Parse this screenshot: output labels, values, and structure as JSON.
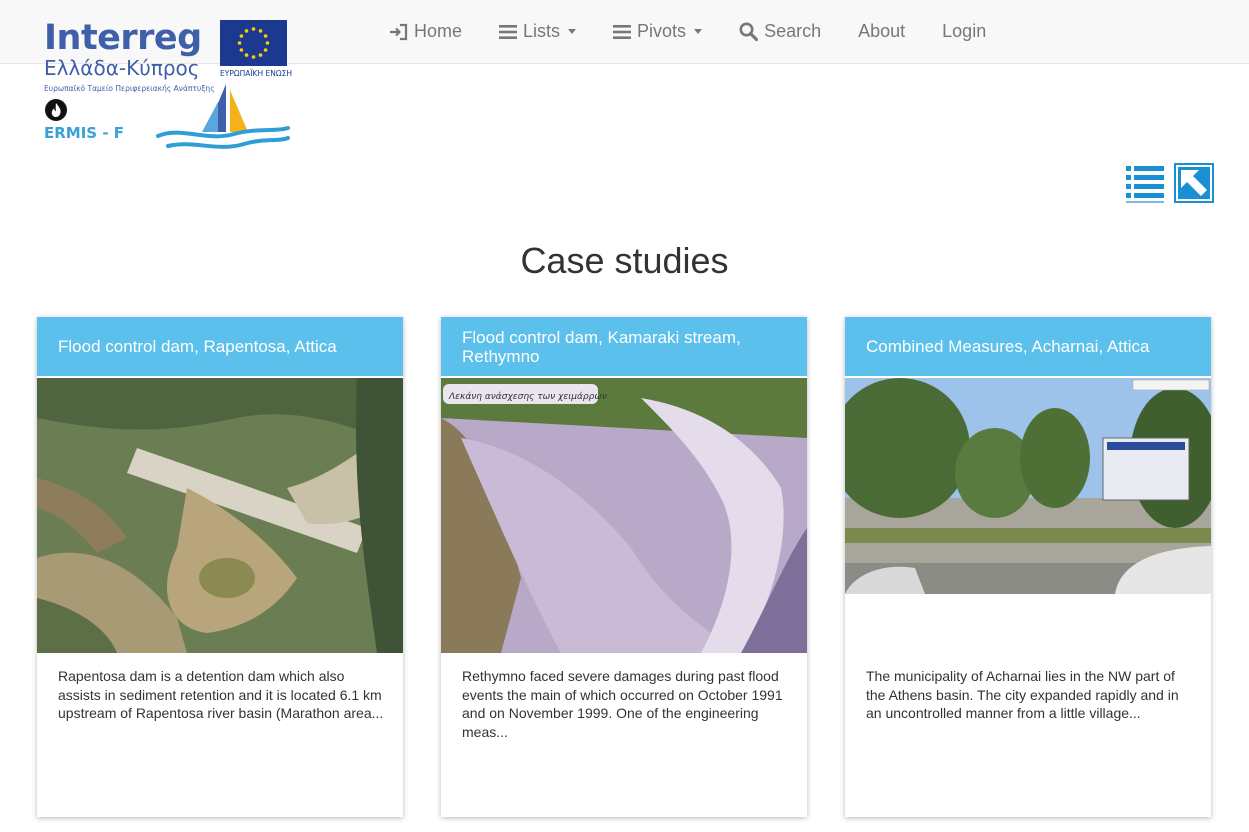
{
  "nav": {
    "items": [
      {
        "label": "Home",
        "icon": "sign-in-icon",
        "dropdown": false
      },
      {
        "label": "Lists",
        "icon": "list-icon",
        "dropdown": true
      },
      {
        "label": "Pivots",
        "icon": "list-icon",
        "dropdown": true
      },
      {
        "label": "Search",
        "icon": "search-icon",
        "dropdown": false
      },
      {
        "label": "About",
        "icon": "",
        "dropdown": false
      },
      {
        "label": "Login",
        "icon": "",
        "dropdown": false
      }
    ]
  },
  "logo": {
    "brand": "Interreg",
    "region": "Ελλάδα-Κύπρος",
    "fund": "Ευρωπαϊκό Ταμείο Περιφερειακής Ανάπτυξης",
    "eu_label": "ΕΥΡΩΠΑΪΚΗ ΕΝΩΣΗ",
    "project": "ERMIS - F"
  },
  "view_toggle": [
    "list-view-icon",
    "map-view-icon"
  ],
  "page": {
    "title": "Case studies"
  },
  "cards": [
    {
      "title": "Flood control dam, Rapentosa, Attica",
      "image": "aerial-dam-photo",
      "excerpt": "Rapentosa dam is a detention dam which also assists in sediment retention and it is located 6.1 km upstream of Rapentosa river basin (Marathon area..."
    },
    {
      "title": "Flood control dam, Kamaraki stream, Rethymno",
      "image": "stream-channel-photo",
      "image_caption": "Λεκάνη ανάσχεσης των χειμάρρων",
      "excerpt": "Rethymno faced severe damages during past flood events the main of which occurred on October 1991 and on November 1999. One of the engineering meas..."
    },
    {
      "title": "Combined Measures, Acharnai, Attica",
      "image": "street-view-photo",
      "excerpt": "The municipality of Acharnai lies in the NW part of the Athens basin. The city expanded rapidly and in an uncontrolled manner from a little village..."
    }
  ],
  "colors": {
    "card_header": "#5bc0eb",
    "accent": "#1a8fd4",
    "navbar_bg": "#f8f8f8",
    "nav_text": "#777777"
  }
}
